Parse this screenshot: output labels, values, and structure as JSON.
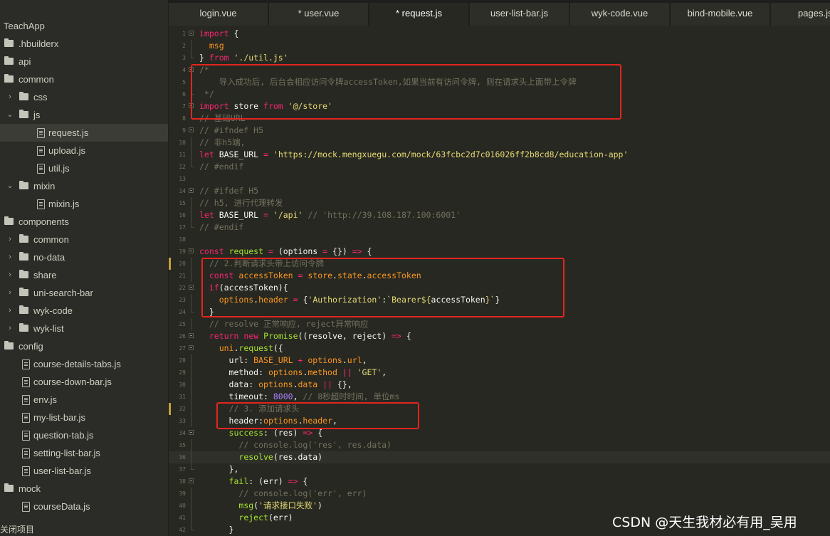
{
  "sidebar": {
    "title": "TeachApp",
    "items": [
      {
        "label": ".hbuilderx",
        "kind": "folder",
        "depth": 0,
        "chevron": ""
      },
      {
        "label": "api",
        "kind": "folder",
        "depth": 0,
        "chevron": ""
      },
      {
        "label": "common",
        "kind": "folder",
        "depth": 0,
        "chevron": ""
      },
      {
        "label": "css",
        "kind": "folder",
        "depth": 1,
        "chevron": "›"
      },
      {
        "label": "js",
        "kind": "folder",
        "depth": 1,
        "chevron": "⌄"
      },
      {
        "label": "request.js",
        "kind": "file",
        "depth": 2,
        "chevron": "",
        "selected": true
      },
      {
        "label": "upload.js",
        "kind": "file",
        "depth": 2,
        "chevron": ""
      },
      {
        "label": "util.js",
        "kind": "file",
        "depth": 2,
        "chevron": ""
      },
      {
        "label": "mixin",
        "kind": "folder",
        "depth": 1,
        "chevron": "⌄"
      },
      {
        "label": "mixin.js",
        "kind": "file",
        "depth": 2,
        "chevron": ""
      },
      {
        "label": "components",
        "kind": "folder",
        "depth": 0,
        "chevron": ""
      },
      {
        "label": "common",
        "kind": "folder",
        "depth": 1,
        "chevron": "›"
      },
      {
        "label": "no-data",
        "kind": "folder",
        "depth": 1,
        "chevron": "›"
      },
      {
        "label": "share",
        "kind": "folder",
        "depth": 1,
        "chevron": "›"
      },
      {
        "label": "uni-search-bar",
        "kind": "folder",
        "depth": 1,
        "chevron": "›"
      },
      {
        "label": "wyk-code",
        "kind": "folder",
        "depth": 1,
        "chevron": "›"
      },
      {
        "label": "wyk-list",
        "kind": "folder",
        "depth": 1,
        "chevron": "›"
      },
      {
        "label": "config",
        "kind": "folder",
        "depth": 0,
        "chevron": ""
      },
      {
        "label": "course-details-tabs.js",
        "kind": "file",
        "depth": 1,
        "chevron": ""
      },
      {
        "label": "course-down-bar.js",
        "kind": "file",
        "depth": 1,
        "chevron": ""
      },
      {
        "label": "env.js",
        "kind": "file",
        "depth": 1,
        "chevron": ""
      },
      {
        "label": "my-list-bar.js",
        "kind": "file",
        "depth": 1,
        "chevron": ""
      },
      {
        "label": "question-tab.js",
        "kind": "file",
        "depth": 1,
        "chevron": ""
      },
      {
        "label": "setting-list-bar.js",
        "kind": "file",
        "depth": 1,
        "chevron": ""
      },
      {
        "label": "user-list-bar.js",
        "kind": "file",
        "depth": 1,
        "chevron": ""
      },
      {
        "label": "mock",
        "kind": "folder",
        "depth": 0,
        "chevron": ""
      },
      {
        "label": "courseData.js",
        "kind": "file",
        "depth": 1,
        "chevron": ""
      }
    ],
    "footer": "关闭项目"
  },
  "tabs": [
    {
      "label": "login.vue",
      "active": false
    },
    {
      "label": "* user.vue",
      "active": false
    },
    {
      "label": "* request.js",
      "active": true
    },
    {
      "label": "user-list-bar.js",
      "active": false
    },
    {
      "label": "wyk-code.vue",
      "active": false
    },
    {
      "label": "bind-mobile.vue",
      "active": false
    },
    {
      "label": "pages.json",
      "active": false
    }
  ],
  "editor": {
    "lines": [
      {
        "n": "1",
        "fold": "open",
        "tokens": [
          [
            "kw",
            "import"
          ],
          [
            "plain",
            " {"
          ]
        ]
      },
      {
        "n": "2",
        "fold": "bar",
        "tokens": [
          [
            "plain",
            "  "
          ],
          [
            "prop",
            "msg"
          ]
        ]
      },
      {
        "n": "3",
        "fold": "end",
        "tokens": [
          [
            "plain",
            "} "
          ],
          [
            "kw",
            "from"
          ],
          [
            "plain",
            " "
          ],
          [
            "str",
            "'./util.js'"
          ]
        ]
      },
      {
        "n": "4",
        "fold": "open",
        "tokens": [
          [
            "com",
            "/*"
          ]
        ]
      },
      {
        "n": "5",
        "fold": "bar",
        "tokens": [
          [
            "com",
            "    导入成功后, 后台会相应访问令牌accessToken,如果当前有访问令牌, 则在请求头上面带上令牌"
          ]
        ]
      },
      {
        "n": "6",
        "fold": "end",
        "tokens": [
          [
            "com",
            " */"
          ]
        ]
      },
      {
        "n": "7",
        "fold": "open",
        "tokens": [
          [
            "kw",
            "import"
          ],
          [
            "plain",
            " store "
          ],
          [
            "kw",
            "from"
          ],
          [
            "plain",
            " "
          ],
          [
            "str",
            "'@/store'"
          ]
        ]
      },
      {
        "n": "8",
        "fold": "end",
        "tokens": [
          [
            "com",
            "// 基础URL"
          ]
        ]
      },
      {
        "n": "9",
        "fold": "open",
        "tokens": [
          [
            "com",
            "// #ifndef H5"
          ]
        ]
      },
      {
        "n": "10",
        "fold": "bar",
        "tokens": [
          [
            "com",
            "// 非h5端,"
          ]
        ]
      },
      {
        "n": "11",
        "fold": "bar",
        "tokens": [
          [
            "kw",
            "let"
          ],
          [
            "plain",
            " BASE_URL "
          ],
          [
            "kw",
            "="
          ],
          [
            "plain",
            " "
          ],
          [
            "str",
            "'https://mock.mengxuegu.com/mock/63fcbc2d7c016026ff2b8cd8/education-app'"
          ]
        ]
      },
      {
        "n": "12",
        "fold": "end",
        "tokens": [
          [
            "com",
            "// #endif"
          ]
        ]
      },
      {
        "n": "13",
        "fold": "",
        "tokens": []
      },
      {
        "n": "14",
        "fold": "open",
        "tokens": [
          [
            "com",
            "// #ifdef H5"
          ]
        ]
      },
      {
        "n": "15",
        "fold": "bar",
        "tokens": [
          [
            "com",
            "// h5, 进行代理转发"
          ]
        ]
      },
      {
        "n": "16",
        "fold": "bar",
        "tokens": [
          [
            "kw",
            "let"
          ],
          [
            "plain",
            " BASE_URL "
          ],
          [
            "kw",
            "="
          ],
          [
            "plain",
            " "
          ],
          [
            "str",
            "'/api'"
          ],
          [
            "plain",
            " "
          ],
          [
            "com",
            "// 'http://39.108.187.100:6001'"
          ]
        ]
      },
      {
        "n": "17",
        "fold": "end",
        "tokens": [
          [
            "com",
            "// #endif"
          ]
        ]
      },
      {
        "n": "18",
        "fold": "",
        "tokens": []
      },
      {
        "n": "19",
        "fold": "open",
        "tokens": [
          [
            "kw",
            "const"
          ],
          [
            "plain",
            " "
          ],
          [
            "fn",
            "request"
          ],
          [
            "plain",
            " "
          ],
          [
            "kw",
            "="
          ],
          [
            "plain",
            " (options "
          ],
          [
            "kw",
            "="
          ],
          [
            "plain",
            " {}) "
          ],
          [
            "kw",
            "=>"
          ],
          [
            "plain",
            " {"
          ]
        ]
      },
      {
        "n": "20",
        "fold": "bar",
        "mark": true,
        "tokens": [
          [
            "plain",
            "  "
          ],
          [
            "com",
            "// 2.判断请求头带上访问令牌"
          ]
        ]
      },
      {
        "n": "21",
        "fold": "bar",
        "tokens": [
          [
            "plain",
            "  "
          ],
          [
            "kw",
            "const"
          ],
          [
            "plain",
            " "
          ],
          [
            "prop",
            "accessToken"
          ],
          [
            "plain",
            " "
          ],
          [
            "kw",
            "="
          ],
          [
            "plain",
            " "
          ],
          [
            "prop",
            "store"
          ],
          [
            "plain",
            "."
          ],
          [
            "prop",
            "state"
          ],
          [
            "plain",
            "."
          ],
          [
            "prop",
            "accessToken"
          ]
        ]
      },
      {
        "n": "22",
        "fold": "open",
        "tokens": [
          [
            "plain",
            "  "
          ],
          [
            "kw",
            "if"
          ],
          [
            "plain",
            "(accessToken){"
          ]
        ]
      },
      {
        "n": "23",
        "fold": "bar",
        "tokens": [
          [
            "plain",
            "    "
          ],
          [
            "prop",
            "options"
          ],
          [
            "plain",
            "."
          ],
          [
            "prop",
            "header"
          ],
          [
            "plain",
            " "
          ],
          [
            "kw",
            "="
          ],
          [
            "plain",
            " {"
          ],
          [
            "str",
            "'Authorization'"
          ],
          [
            "plain",
            ":"
          ],
          [
            "str",
            "`Bearer${"
          ],
          [
            "plain",
            "accessToken"
          ],
          [
            "str",
            "}`"
          ],
          [
            "plain",
            "}"
          ]
        ]
      },
      {
        "n": "24",
        "fold": "end",
        "tokens": [
          [
            "plain",
            "  }"
          ]
        ]
      },
      {
        "n": "25",
        "fold": "bar",
        "tokens": [
          [
            "plain",
            "  "
          ],
          [
            "com",
            "// resolve 正常响应, reject异常响应"
          ]
        ]
      },
      {
        "n": "26",
        "fold": "open",
        "tokens": [
          [
            "plain",
            "  "
          ],
          [
            "kw",
            "return"
          ],
          [
            "plain",
            " "
          ],
          [
            "kw",
            "new"
          ],
          [
            "plain",
            " "
          ],
          [
            "cls",
            "Promise"
          ],
          [
            "plain",
            "((resolve, reject) "
          ],
          [
            "kw",
            "=>"
          ],
          [
            "plain",
            " {"
          ]
        ]
      },
      {
        "n": "27",
        "fold": "open",
        "tokens": [
          [
            "plain",
            "    "
          ],
          [
            "prop",
            "uni"
          ],
          [
            "plain",
            "."
          ],
          [
            "fn",
            "request"
          ],
          [
            "plain",
            "({"
          ]
        ]
      },
      {
        "n": "28",
        "fold": "bar",
        "tokens": [
          [
            "plain",
            "      url: "
          ],
          [
            "prop",
            "BASE_URL"
          ],
          [
            "plain",
            " "
          ],
          [
            "kw",
            "+"
          ],
          [
            "plain",
            " "
          ],
          [
            "prop",
            "options"
          ],
          [
            "plain",
            "."
          ],
          [
            "prop",
            "url"
          ],
          [
            "plain",
            ","
          ]
        ]
      },
      {
        "n": "29",
        "fold": "bar",
        "tokens": [
          [
            "plain",
            "      method: "
          ],
          [
            "prop",
            "options"
          ],
          [
            "plain",
            "."
          ],
          [
            "prop",
            "method"
          ],
          [
            "plain",
            " "
          ],
          [
            "kw",
            "||"
          ],
          [
            "plain",
            " "
          ],
          [
            "str",
            "'GET'"
          ],
          [
            "plain",
            ","
          ]
        ]
      },
      {
        "n": "30",
        "fold": "bar",
        "tokens": [
          [
            "plain",
            "      data: "
          ],
          [
            "prop",
            "options"
          ],
          [
            "plain",
            "."
          ],
          [
            "prop",
            "data"
          ],
          [
            "plain",
            " "
          ],
          [
            "kw",
            "||"
          ],
          [
            "plain",
            " {},"
          ]
        ]
      },
      {
        "n": "31",
        "fold": "bar",
        "tokens": [
          [
            "plain",
            "      timeout: "
          ],
          [
            "num",
            "8000"
          ],
          [
            "plain",
            ", "
          ],
          [
            "com",
            "// 8秒超时时间, 单位ms"
          ]
        ]
      },
      {
        "n": "32",
        "fold": "bar",
        "mark": true,
        "tokens": [
          [
            "plain",
            "      "
          ],
          [
            "com",
            "// 3. 添加请求头"
          ]
        ]
      },
      {
        "n": "33",
        "fold": "bar",
        "tokens": [
          [
            "plain",
            "      header:"
          ],
          [
            "prop",
            "options"
          ],
          [
            "plain",
            "."
          ],
          [
            "prop",
            "header"
          ],
          [
            "plain",
            ","
          ]
        ]
      },
      {
        "n": "34",
        "fold": "open",
        "tokens": [
          [
            "plain",
            "      "
          ],
          [
            "fn",
            "success"
          ],
          [
            "plain",
            ": (res) "
          ],
          [
            "kw",
            "=>"
          ],
          [
            "plain",
            " {"
          ]
        ]
      },
      {
        "n": "35",
        "fold": "bar",
        "tokens": [
          [
            "plain",
            "        "
          ],
          [
            "com",
            "// console.log('res', res.data)"
          ]
        ]
      },
      {
        "n": "36",
        "fold": "bar",
        "cur": true,
        "tokens": [
          [
            "plain",
            "        "
          ],
          [
            "fn",
            "resolve"
          ],
          [
            "plain",
            "(res.data)"
          ]
        ]
      },
      {
        "n": "37",
        "fold": "end",
        "tokens": [
          [
            "plain",
            "      },"
          ]
        ]
      },
      {
        "n": "38",
        "fold": "open",
        "tokens": [
          [
            "plain",
            "      "
          ],
          [
            "fn",
            "fail"
          ],
          [
            "plain",
            ": (err) "
          ],
          [
            "kw",
            "=>"
          ],
          [
            "plain",
            " {"
          ]
        ]
      },
      {
        "n": "39",
        "fold": "bar",
        "tokens": [
          [
            "plain",
            "        "
          ],
          [
            "com",
            "// console.log('err', err)"
          ]
        ]
      },
      {
        "n": "40",
        "fold": "bar",
        "tokens": [
          [
            "plain",
            "        "
          ],
          [
            "fn",
            "msg"
          ],
          [
            "plain",
            "("
          ],
          [
            "str",
            "'请求接口失败'"
          ],
          [
            "plain",
            ")"
          ]
        ]
      },
      {
        "n": "41",
        "fold": "bar",
        "tokens": [
          [
            "plain",
            "        "
          ],
          [
            "fn",
            "reject"
          ],
          [
            "plain",
            "(err)"
          ]
        ]
      },
      {
        "n": "42",
        "fold": "end",
        "tokens": [
          [
            "plain",
            "      }"
          ]
        ]
      }
    ]
  },
  "watermark": "CSDN @天生我材必有用_吴用"
}
